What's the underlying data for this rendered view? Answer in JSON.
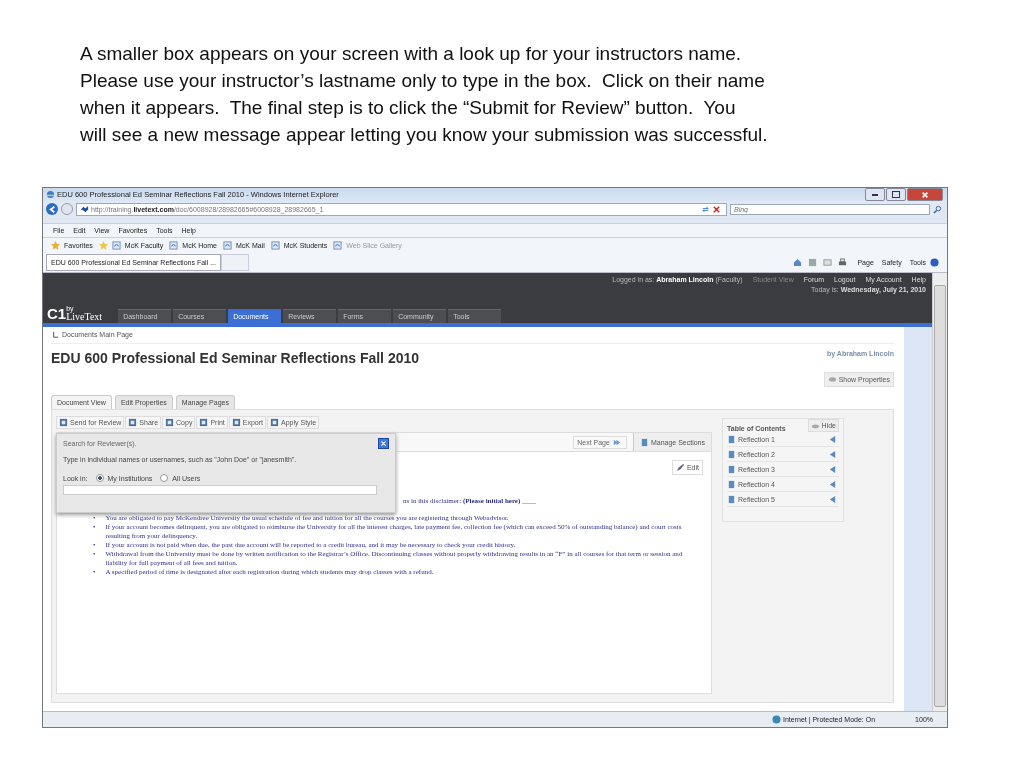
{
  "caption_lines": [
    "A smaller box appears on your screen with a look up for your instructors name.",
    "Please use your instructor’s lastname only to type in the box.  Click on their name",
    "when it appears.  The final step is to click the “Submit for Review” button.  You",
    "will see a new message appear letting you know your submission was successful."
  ],
  "browser": {
    "title": "EDU 600 Professional Ed Seminar Reflections Fall 2010 - Windows Internet Explorer",
    "url": "http://training.**livetext.com**/doc/6008928/28982665#6008928_28982665_1",
    "search_placeholder": "Bing",
    "menu": [
      "File",
      "Edit",
      "View",
      "Favorites",
      "Tools",
      "Help"
    ],
    "favorites_label": "Favorites",
    "favorites": [
      {
        "label": "McK Faculty",
        "disabled": false
      },
      {
        "label": "McK Home",
        "disabled": false
      },
      {
        "label": "McK Mail",
        "disabled": false
      },
      {
        "label": "McK Students",
        "disabled": false
      },
      {
        "label": "Web Slice Gallery",
        "disabled": true
      }
    ],
    "tab": "EDU 600 Professional Ed Seminar Reflections Fall ...",
    "commands": [
      "Page",
      "Safety",
      "Tools"
    ],
    "status": "Internet | Protected Mode: On",
    "zoom": "100%"
  },
  "site": {
    "logged_in": "Logged in as: **Abraham Lincoln** (Faculty)",
    "top_links": [
      {
        "label": "Student View",
        "disabled": true
      },
      {
        "label": "Forum",
        "disabled": false
      },
      {
        "label": "Logout",
        "disabled": false
      },
      {
        "label": "My Account",
        "disabled": false
      },
      {
        "label": "Help",
        "disabled": false
      }
    ],
    "today": "Today is: **Wednesday, July 21, 2010**",
    "logo": {
      "mark": "C1",
      "by": "by",
      "name": "LiveText"
    },
    "nav": [
      {
        "label": "Dashboard",
        "selected": false
      },
      {
        "label": "Courses",
        "selected": false
      },
      {
        "label": "Documents",
        "selected": true
      },
      {
        "label": "Reviews",
        "selected": false
      },
      {
        "label": "Forms",
        "selected": false
      },
      {
        "label": "Community",
        "selected": false
      },
      {
        "label": "Tools",
        "selected": false
      }
    ],
    "breadcrumb": "Documents Main Page",
    "title": "EDU 600 Professional Ed Seminar Reflections Fall 2010",
    "author": "by Abraham Lincoln",
    "show_properties": "Show Properties",
    "doc_tabs": [
      {
        "label": "Document View",
        "selected": true
      },
      {
        "label": "Edit Properties",
        "selected": false
      },
      {
        "label": "Manage Pages",
        "selected": false
      }
    ],
    "toolbar": [
      "Send for Review",
      "Share",
      "Copy",
      "Print",
      "Export",
      "Apply Style"
    ],
    "next_page": "Next Page",
    "manage_sections": "Manage Sections",
    "edit": "Edit",
    "disclaimer": "ns in this disclaimer:  **(Please initial here)**  ____",
    "bullets": [
      {
        "marker": "•",
        "text": "You are obligated to pay McKendree University the usual schedule of fee and tuition for all the courses you are registering through Webadvisor."
      },
      {
        "marker": "•",
        "text": "If your account becomes delinquent, you are obligated to reimburse the University for all the interest charges, late payment fee, collection fee (which can exceed 50% of outstanding balance) and court costs resulting from your delinquency."
      },
      {
        "marker": "•",
        "text": "If your account is not paid when due, the past due account will be reported to a credit bureau, and it may be necessary to check your credit history."
      },
      {
        "marker": "•",
        "text": "Withdrawal from the University must be done by written notification to the Registrar’s Office. Discontinuing classes without properly withdrawing results in an “F” in all courses for that term or session and liability for full payment of all fees and tuition."
      },
      {
        "marker": "•",
        "text": "A specified period of time is designated after each registration during which students may drop classes with a refund."
      }
    ],
    "toc_title": "Table of Contents",
    "hide": "Hide",
    "toc": [
      "Reflection 1",
      "Reflection 2",
      "Reflection 3",
      "Reflection 4",
      "Reflection 5"
    ],
    "dialog": {
      "title": "Search for Reviewer(s).",
      "instruction": "Type in individual names or usernames, such as \"John Doe\" or \"janesmith\".",
      "look_in": "Look in:",
      "options": [
        {
          "label": "My Institutions",
          "selected": true
        },
        {
          "label": "All Users",
          "selected": false
        }
      ]
    }
  }
}
